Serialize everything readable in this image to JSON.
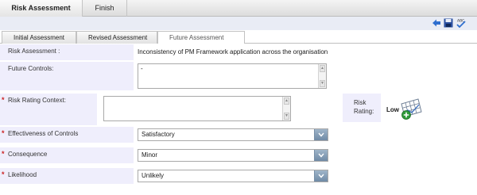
{
  "wizard": {
    "tabs": [
      {
        "label": "Risk Assessment"
      },
      {
        "label": "Finish"
      }
    ]
  },
  "toolbar": {
    "icons": [
      "back-arrow-icon",
      "save-icon",
      "spellcheck-icon"
    ],
    "spellcheck_text": "ABC"
  },
  "subtabs": [
    {
      "label": "Initial Assessment"
    },
    {
      "label": "Revised Assessment"
    },
    {
      "label": "Future Assessment"
    }
  ],
  "form": {
    "risk_assessment": {
      "label": "Risk Assessment :",
      "value": "Inconsistency of PM Framework application across the organisation"
    },
    "future_controls": {
      "label": "Future Controls:",
      "value": "-"
    },
    "risk_rating_context": {
      "label": "Risk Rating Context:",
      "value": ""
    },
    "risk_rating": {
      "label": "Risk Rating:",
      "value": "Low"
    },
    "effectiveness": {
      "label": "Effectiveness of Controls",
      "value": "Satisfactory"
    },
    "consequence": {
      "label": "Consequence",
      "value": "Minor"
    },
    "likelihood": {
      "label": "Likelihood",
      "value": "Unlikely"
    },
    "required_marker": "*"
  },
  "colors": {
    "label_bg": "#efeefc",
    "required": "#cc2222",
    "select_button": "#7f99b3"
  }
}
